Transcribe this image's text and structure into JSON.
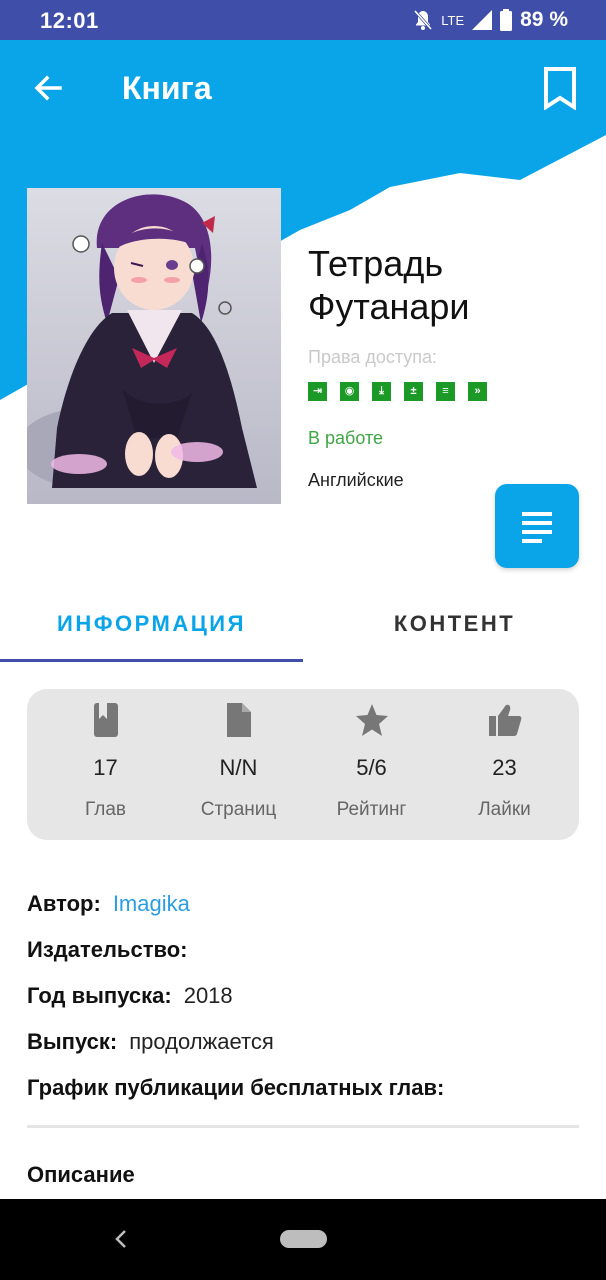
{
  "status_bar": {
    "time": "12:01",
    "network": "LTE",
    "battery": "89 %"
  },
  "app_bar": {
    "title": "Книга",
    "back_icon": "arrow-back-icon",
    "bookmark_icon": "bookmark-icon"
  },
  "book": {
    "title": "Тетрадь Футанари",
    "access_label": "Права доступа:",
    "permission_icons": [
      "login-icon",
      "eye-icon",
      "download-icon",
      "plus-minus-icon",
      "comment-icon",
      "forward-icon"
    ],
    "status": "В работе",
    "language": "Английские",
    "fab_icon": "list-icon"
  },
  "tabs": [
    {
      "label": "ИНФОРМАЦИЯ",
      "active": true
    },
    {
      "label": "КОНТЕНТ",
      "active": false
    }
  ],
  "stats": [
    {
      "icon": "book-icon",
      "value": "17",
      "label": "Глав"
    },
    {
      "icon": "document-icon",
      "value": "N/N",
      "label": "Страниц"
    },
    {
      "icon": "star-icon",
      "value": "5/6",
      "label": "Рейтинг"
    },
    {
      "icon": "thumb-up-icon",
      "value": "23",
      "label": "Лайки"
    }
  ],
  "info": {
    "author_key": "Автор:",
    "author_val": "Imagika",
    "publisher_key": "Издательство:",
    "publisher_val": "",
    "year_key": "Год выпуска:",
    "year_val": "2018",
    "release_key": "Выпуск:",
    "release_val": "продолжается",
    "schedule_key": "График публикации бесплатных глав:",
    "schedule_val": ""
  },
  "description_title": "Описание",
  "colors": {
    "primary": "#0aa5e8",
    "status_bar": "#3f4ea9",
    "status_text": "#41a447",
    "permission_icon": "#1c9a28"
  }
}
